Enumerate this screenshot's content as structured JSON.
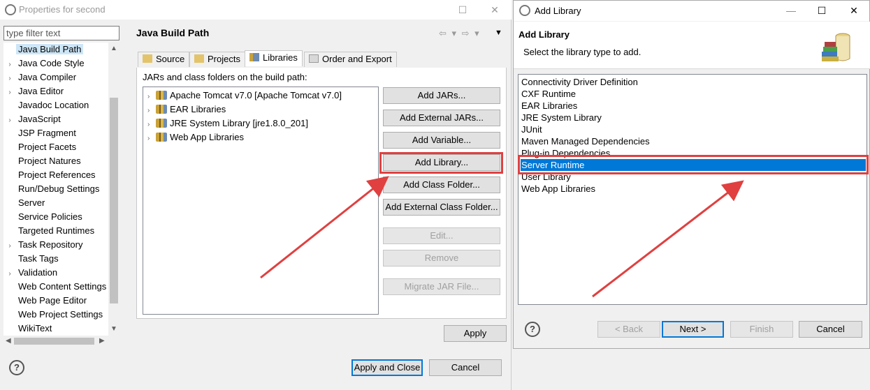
{
  "properties_window": {
    "title": "Properties for second",
    "filter_placeholder": "type filter text",
    "nav_items": [
      {
        "label": "Java Build Path",
        "expandable": false,
        "selected": true
      },
      {
        "label": "Java Code Style",
        "expandable": true
      },
      {
        "label": "Java Compiler",
        "expandable": true
      },
      {
        "label": "Java Editor",
        "expandable": true
      },
      {
        "label": "Javadoc Location",
        "expandable": false
      },
      {
        "label": "JavaScript",
        "expandable": true
      },
      {
        "label": "JSP Fragment",
        "expandable": false
      },
      {
        "label": "Project Facets",
        "expandable": false
      },
      {
        "label": "Project Natures",
        "expandable": false
      },
      {
        "label": "Project References",
        "expandable": false
      },
      {
        "label": "Run/Debug Settings",
        "expandable": false
      },
      {
        "label": "Server",
        "expandable": false
      },
      {
        "label": "Service Policies",
        "expandable": false
      },
      {
        "label": "Targeted Runtimes",
        "expandable": false
      },
      {
        "label": "Task Repository",
        "expandable": true
      },
      {
        "label": "Task Tags",
        "expandable": false
      },
      {
        "label": "Validation",
        "expandable": true
      },
      {
        "label": "Web Content Settings",
        "expandable": false
      },
      {
        "label": "Web Page Editor",
        "expandable": false
      },
      {
        "label": "Web Project Settings",
        "expandable": false
      },
      {
        "label": "WikiText",
        "expandable": false
      }
    ],
    "panel_title": "Java Build Path",
    "tabs": [
      {
        "label": "Source",
        "icon": "source-folder-icon"
      },
      {
        "label": "Projects",
        "icon": "projects-icon"
      },
      {
        "label": "Libraries",
        "icon": "libraries-icon",
        "active": true
      },
      {
        "label": "Order and Export",
        "icon": "order-export-icon"
      }
    ],
    "jars_label": "JARs and class folders on the build path:",
    "libraries": [
      "Apache Tomcat v7.0 [Apache Tomcat v7.0]",
      "EAR Libraries",
      "JRE System Library [jre1.8.0_201]",
      "Web App Libraries"
    ],
    "buttons": {
      "add_jars": "Add JARs...",
      "add_external_jars": "Add External JARs...",
      "add_variable": "Add Variable...",
      "add_library": "Add Library...",
      "add_class_folder": "Add Class Folder...",
      "add_external_class_folder": "Add External Class Folder...",
      "edit": "Edit...",
      "remove": "Remove",
      "migrate_jar": "Migrate JAR File...",
      "apply": "Apply",
      "apply_and_close": "Apply and Close",
      "cancel": "Cancel"
    },
    "help": "?"
  },
  "add_library_dialog": {
    "title": "Add Library",
    "heading": "Add Library",
    "subheading": "Select the library type to add.",
    "library_types": [
      {
        "label": "Connectivity Driver Definition"
      },
      {
        "label": "CXF Runtime"
      },
      {
        "label": "EAR Libraries"
      },
      {
        "label": "JRE System Library"
      },
      {
        "label": "JUnit"
      },
      {
        "label": "Maven Managed Dependencies"
      },
      {
        "label": "Plug-in Dependencies"
      },
      {
        "label": "Server Runtime",
        "selected": true
      },
      {
        "label": "User Library"
      },
      {
        "label": "Web App Libraries"
      }
    ],
    "buttons": {
      "back": "< Back",
      "next": "Next >",
      "finish": "Finish",
      "cancel": "Cancel"
    },
    "help": "?"
  },
  "colors": {
    "highlight_box": "#e04040",
    "selection": "#0078d7",
    "nav_selection": "#cde6f7"
  }
}
